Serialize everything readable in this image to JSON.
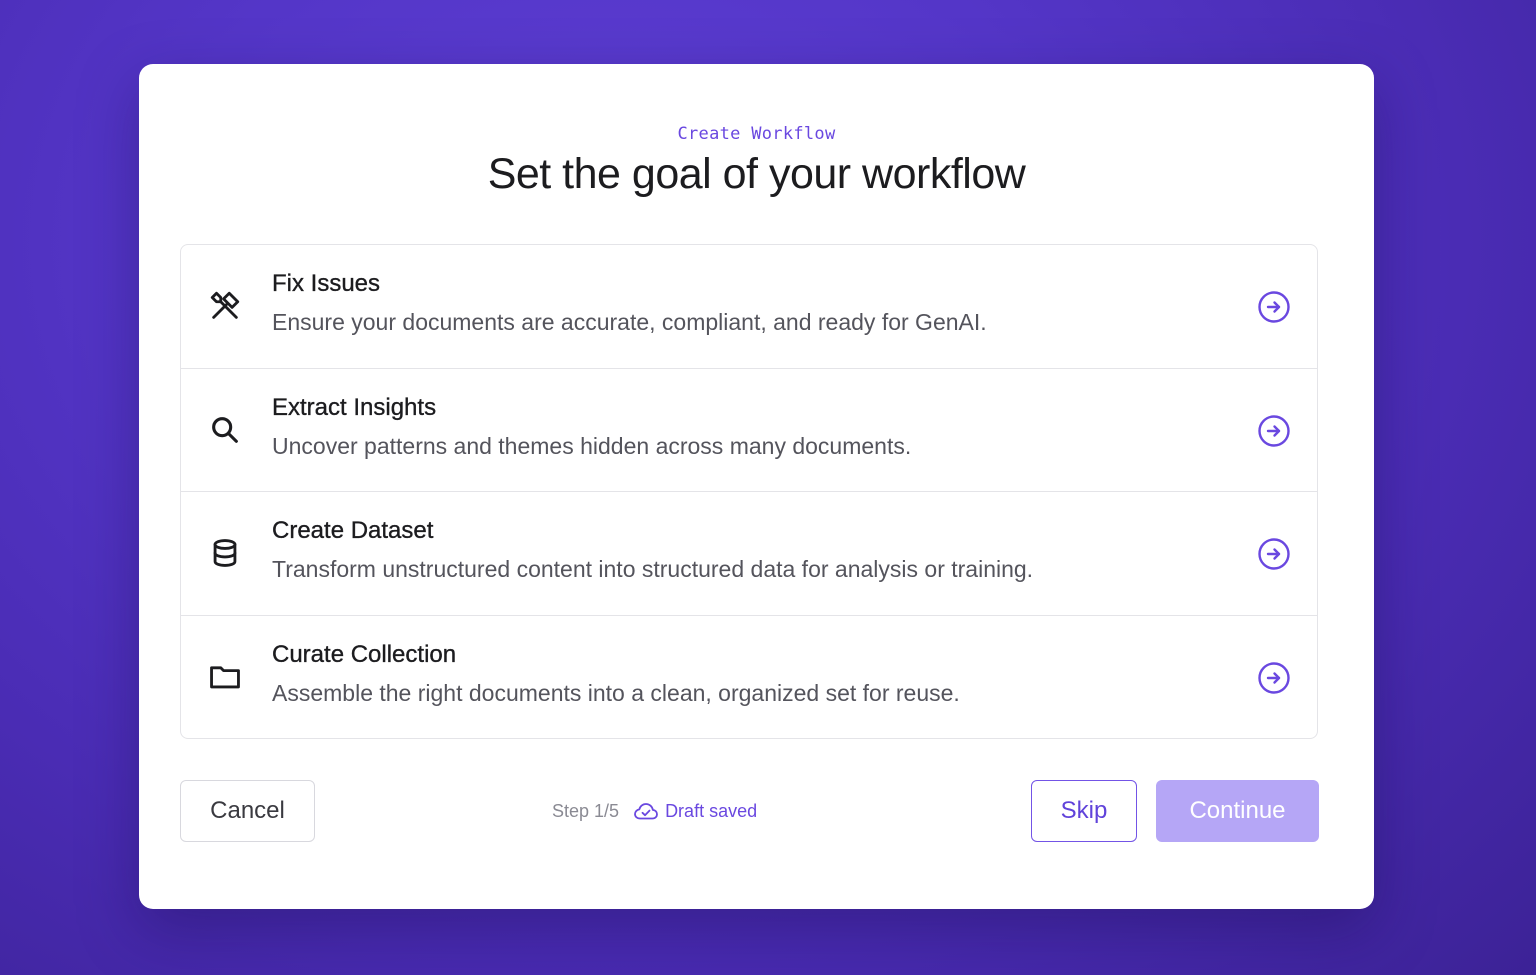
{
  "modal": {
    "eyebrow": "Create Workflow",
    "title": "Set the goal of your workflow"
  },
  "options": [
    {
      "icon": "tools-icon",
      "title": "Fix Issues",
      "description": "Ensure your documents are accurate, compliant, and ready for GenAI."
    },
    {
      "icon": "search-icon",
      "title": "Extract Insights",
      "description": "Uncover patterns and themes hidden across many documents."
    },
    {
      "icon": "database-icon",
      "title": "Create Dataset",
      "description": "Transform unstructured content into structured data for analysis or training."
    },
    {
      "icon": "folder-icon",
      "title": "Curate Collection",
      "description": "Assemble the right documents into a clean, organized set for reuse."
    }
  ],
  "footer": {
    "cancel_label": "Cancel",
    "step_text": "Step 1/5",
    "draft_text": "Draft saved",
    "skip_label": "Skip",
    "continue_label": "Continue"
  },
  "colors": {
    "accent": "#6a48e0",
    "continue_disabled": "#b5a6f6",
    "background": "#5436c8"
  }
}
